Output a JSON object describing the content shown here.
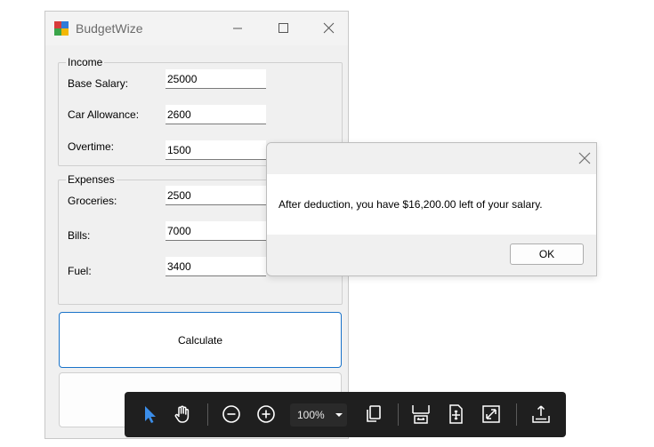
{
  "window": {
    "title": "BudgetWize"
  },
  "income": {
    "legend": "Income",
    "fields": [
      {
        "label": "Base Salary:",
        "value": "25000"
      },
      {
        "label": "Car Allowance:",
        "value": "2600"
      },
      {
        "label": "Overtime:",
        "value": "1500"
      }
    ]
  },
  "expenses": {
    "legend": "Expenses",
    "fields": [
      {
        "label": "Groceries:",
        "value": "2500"
      },
      {
        "label": "Bills:",
        "value": "7000"
      },
      {
        "label": "Fuel:",
        "value": "3400"
      }
    ]
  },
  "buttons": {
    "calculate": "Calculate",
    "second": ""
  },
  "dialog": {
    "message": "After deduction, you have $16,200.00 left of your salary.",
    "ok_label": "OK"
  },
  "toolbar": {
    "zoom": "100%",
    "icons": [
      "select-cursor-icon",
      "hand-pan-icon",
      "zoom-out-icon",
      "zoom-in-icon",
      "page-view-icon",
      "fit-width-icon",
      "fit-page-icon",
      "fullscreen-icon",
      "export-icon"
    ]
  },
  "colors": {
    "accent": "#1a73c9",
    "cursor_blue": "#3b8eea",
    "toolbar_bg": "#1f1f1f"
  }
}
